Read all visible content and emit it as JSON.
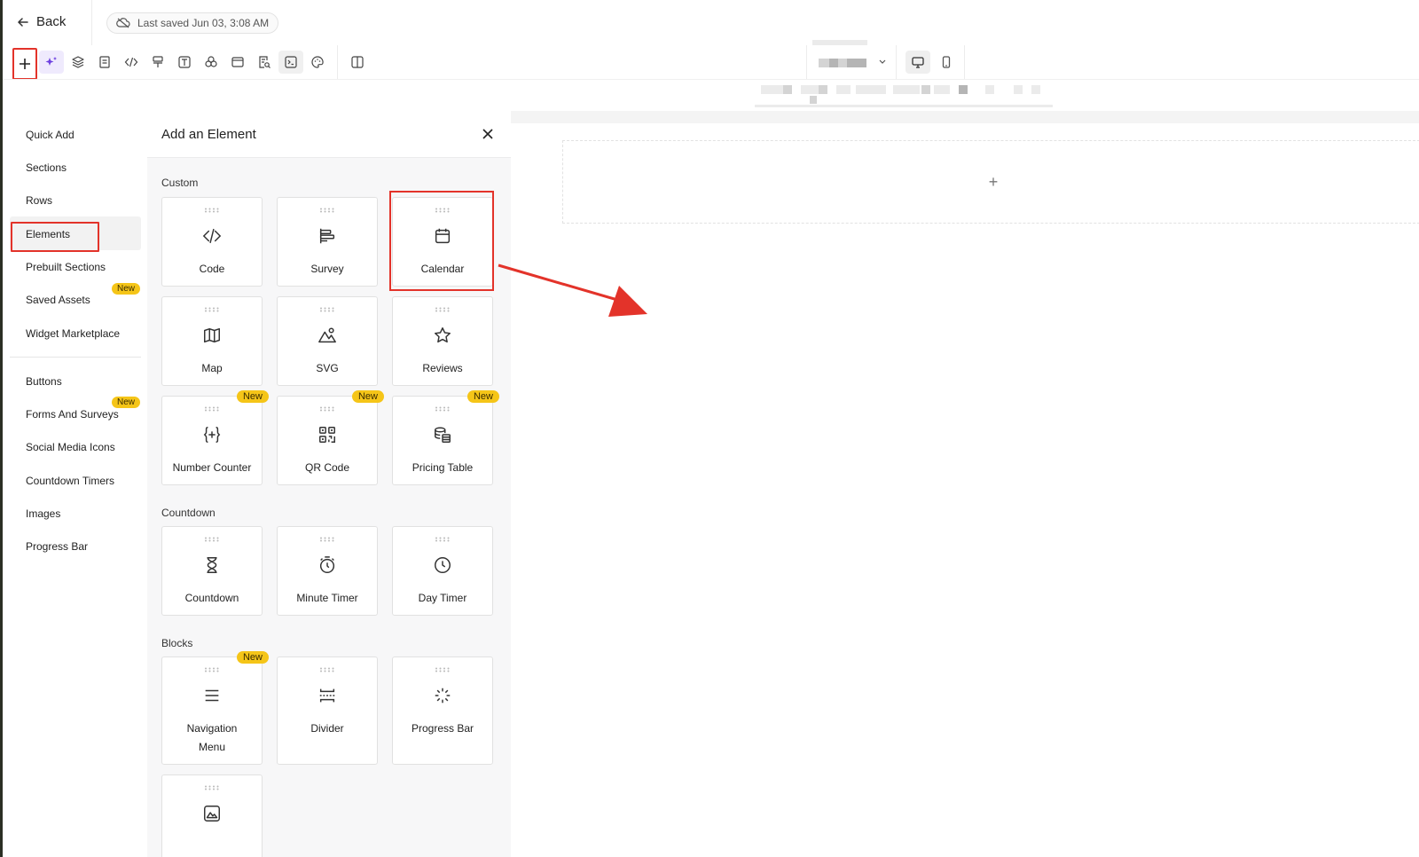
{
  "topbar": {
    "back_label": "Back",
    "saved_label": "Last saved Jun 03, 3:08 AM"
  },
  "toolbar": {
    "icons": [
      "plus-icon",
      "sparkles-icon",
      "layers-icon",
      "page-icon",
      "code-icon",
      "paint-icon",
      "text-icon",
      "components-icon",
      "browser-icon",
      "search-doc-icon",
      "terminal-icon",
      "palette-icon",
      "columns-icon"
    ],
    "devices": [
      "desktop-icon",
      "mobile-icon"
    ]
  },
  "left_nav": {
    "items": [
      {
        "label": "Quick Add"
      },
      {
        "label": "Sections"
      },
      {
        "label": "Rows"
      },
      {
        "label": "Elements"
      },
      {
        "label": "Prebuilt Sections"
      },
      {
        "label": "Saved Assets",
        "badge": "New"
      },
      {
        "label": "Widget Marketplace"
      },
      {
        "label": "Buttons"
      },
      {
        "label": "Forms And Surveys",
        "badge": "New"
      },
      {
        "label": "Social Media Icons"
      },
      {
        "label": "Countdown Timers"
      },
      {
        "label": "Images"
      },
      {
        "label": "Progress Bar"
      }
    ]
  },
  "panel": {
    "title": "Add an Element",
    "sections": [
      {
        "label": "Custom",
        "tiles": [
          {
            "label": "Code",
            "icon": "code-icon"
          },
          {
            "label": "Survey",
            "icon": "survey-icon"
          },
          {
            "label": "Calendar",
            "icon": "calendar-icon"
          },
          {
            "label": "Map",
            "icon": "map-icon"
          },
          {
            "label": "SVG",
            "icon": "svg-icon"
          },
          {
            "label": "Reviews",
            "icon": "star-icon"
          },
          {
            "label": "Number Counter",
            "icon": "number-counter-icon",
            "badge": "New"
          },
          {
            "label": "QR Code",
            "icon": "qr-code-icon",
            "badge": "New"
          },
          {
            "label": "Pricing Table",
            "icon": "pricing-table-icon",
            "badge": "New"
          }
        ]
      },
      {
        "label": "Countdown",
        "tiles": [
          {
            "label": "Countdown",
            "icon": "hourglass-icon"
          },
          {
            "label": "Minute Timer",
            "icon": "stopwatch-icon"
          },
          {
            "label": "Day Timer",
            "icon": "clock-icon"
          }
        ]
      },
      {
        "label": "Blocks",
        "tiles": [
          {
            "label": "Navigation Menu",
            "icon": "menu-icon",
            "badge": "New"
          },
          {
            "label": "Divider",
            "icon": "divider-icon"
          },
          {
            "label": "Progress Bar",
            "icon": "spinner-icon"
          },
          {
            "label": "",
            "icon": "image-icon"
          }
        ]
      }
    ]
  },
  "canvas": {
    "add_symbol": "+"
  },
  "annotations": {
    "color": "#e3332a"
  }
}
